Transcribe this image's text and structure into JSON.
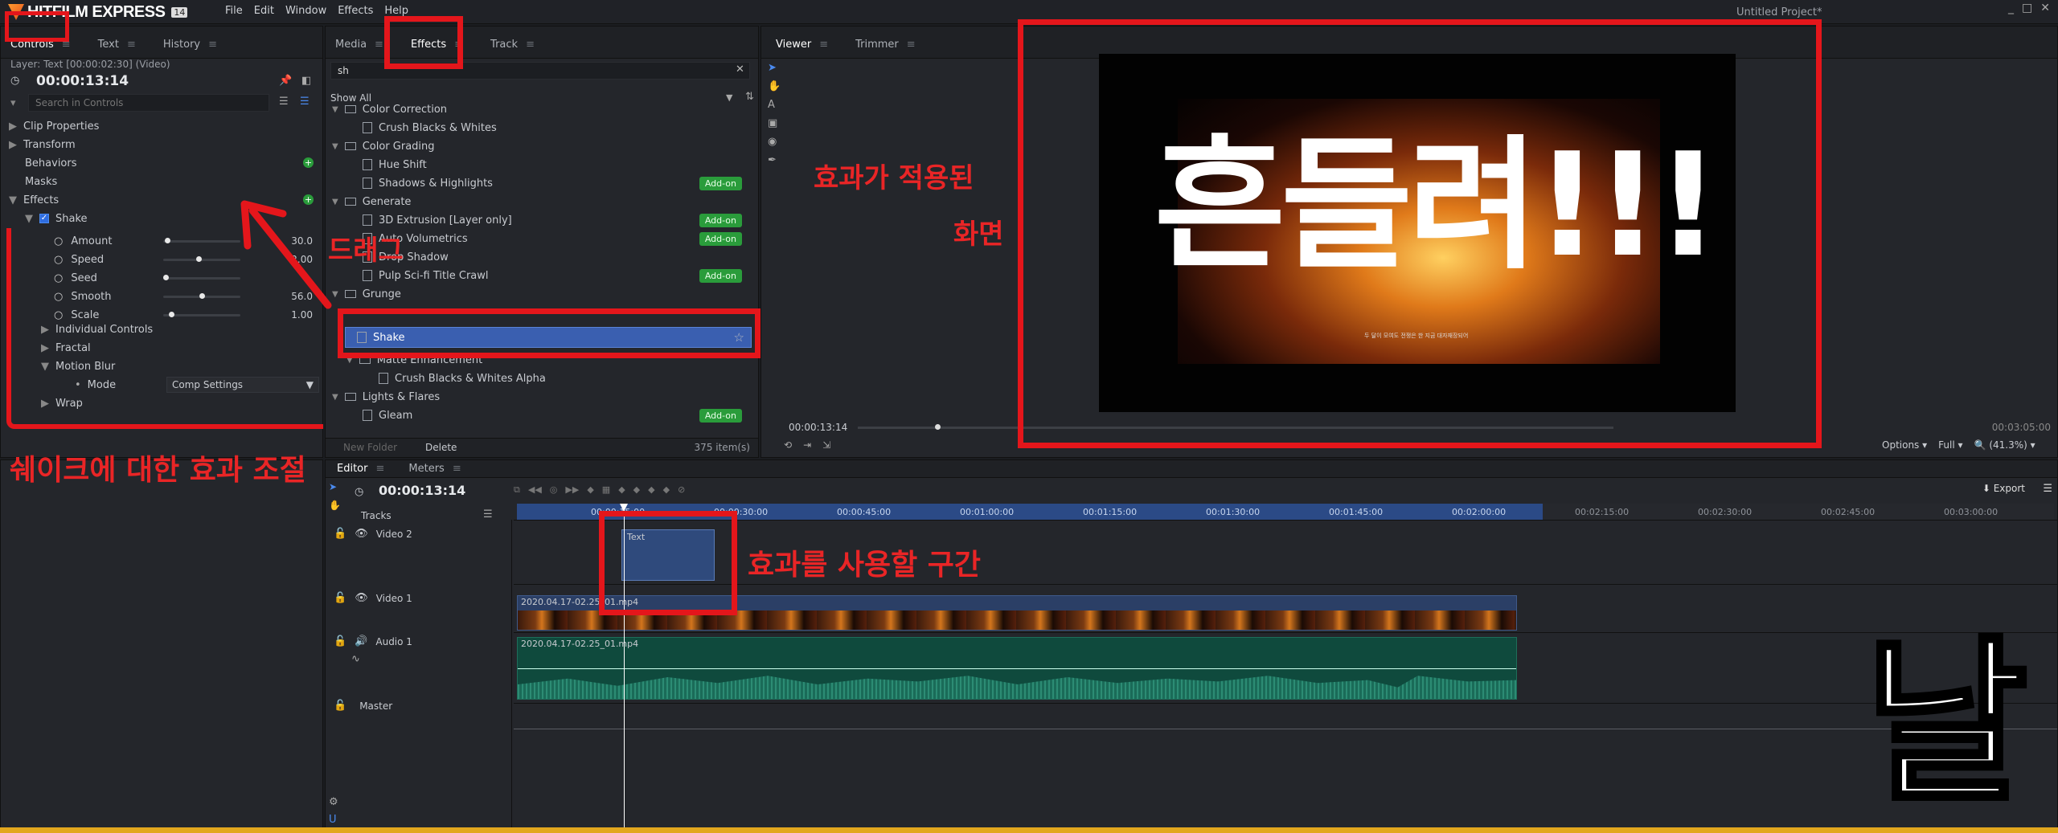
{
  "app": {
    "logo_text": "HITFILM EXPRESS",
    "logo_badge": "14",
    "menu": [
      "File",
      "Edit",
      "Window",
      "Effects",
      "Help"
    ],
    "project_title": "Untitled Project*",
    "window_controls": [
      "_",
      "□",
      "✕"
    ]
  },
  "controls_panel": {
    "tabs": [
      {
        "label": "Controls"
      },
      {
        "label": "Text"
      },
      {
        "label": "History"
      }
    ],
    "layer_info": "Layer: Text [00:00:02:30] (Video)",
    "timecode": "00:00:13:14",
    "search_placeholder": "Search in Controls",
    "tree": {
      "clip_properties": "Clip Properties",
      "transform": "Transform",
      "behaviors": "Behaviors",
      "masks": "Masks",
      "effects": "Effects",
      "shake": "Shake",
      "params": [
        {
          "label": "Amount",
          "value": "30.0",
          "level": 0.02
        },
        {
          "label": "Speed",
          "value": "2.00",
          "level": 0.45
        },
        {
          "label": "Seed",
          "value": "",
          "level": 0.0
        },
        {
          "label": "Smooth",
          "value": "56.0",
          "level": 0.5
        },
        {
          "label": "Scale",
          "value": "1.00",
          "level": 0.08
        }
      ],
      "individual_controls": "Individual Controls",
      "fractal": "Fractal",
      "motion_blur": "Motion Blur",
      "mode_label": "Mode",
      "mode_value": "Comp Settings",
      "wrap": "Wrap"
    }
  },
  "effects_panel": {
    "tabs": [
      {
        "label": "Media"
      },
      {
        "label": "Effects"
      },
      {
        "label": "Track"
      }
    ],
    "search_value": "sh",
    "filter": "Show All",
    "items": [
      {
        "type": "folder",
        "label": "Color Correction",
        "addon": ""
      },
      {
        "type": "effect",
        "label": "Crush Blacks & Whites",
        "addon": ""
      },
      {
        "type": "folder",
        "label": "Color Grading",
        "addon": ""
      },
      {
        "type": "effect",
        "label": "Hue Shift",
        "addon": ""
      },
      {
        "type": "effect",
        "label": "Shadows & Highlights",
        "addon": "Add-on"
      },
      {
        "type": "folder",
        "label": "Generate",
        "addon": ""
      },
      {
        "type": "effect",
        "label": "3D Extrusion [Layer only]",
        "addon": "Add-on"
      },
      {
        "type": "effect",
        "label": "Auto Volumetrics",
        "addon": "Add-on"
      },
      {
        "type": "effect",
        "label": "Drop Shadow",
        "addon": ""
      },
      {
        "type": "effect",
        "label": "Pulp Sci-fi Title Crawl",
        "addon": "Add-on"
      },
      {
        "type": "folder",
        "label": "Grunge",
        "addon": ""
      }
    ],
    "selected_item": "Shake",
    "items_after": [
      {
        "type": "subfolder",
        "label": "Matte Enhancement",
        "addon": ""
      },
      {
        "type": "subeffect",
        "label": "Crush Blacks & Whites Alpha",
        "addon": ""
      },
      {
        "type": "folder",
        "label": "Lights & Flares",
        "addon": ""
      },
      {
        "type": "effect",
        "label": "Gleam",
        "addon": "Add-on"
      }
    ],
    "new_folder": "New Folder",
    "delete": "Delete",
    "item_count": "375 item(s)"
  },
  "viewer": {
    "tabs": [
      {
        "label": "Viewer"
      },
      {
        "label": "Trimmer"
      }
    ],
    "big_text": "흔들려!!!",
    "small_caption": "두 달이 모여도 전쟁은 한 지금 대자재장되어",
    "timecode_left": "00:00:13:14",
    "timecode_right": "00:03:05:00",
    "options": "Options",
    "quality": "Full",
    "zoom": "(41.3%)"
  },
  "editor": {
    "tabs": [
      {
        "label": "Editor"
      },
      {
        "label": "Meters"
      }
    ],
    "timecode": "00:00:13:14",
    "tracks_label": "Tracks",
    "export": "Export",
    "ruler": [
      "00:00:15:00",
      "00:00:30:00",
      "00:00:45:00",
      "00:01:00:00",
      "00:01:15:00",
      "00:01:30:00",
      "00:01:45:00",
      "00:02:00:00",
      "00:02:15:00",
      "00:02:30:00",
      "00:02:45:00",
      "00:03:00:00"
    ],
    "tracks": [
      {
        "name": "Video 2",
        "clip": "Text"
      },
      {
        "name": "Video 1",
        "clip": "2020.04.17-02.25_01.mp4"
      },
      {
        "name": "Audio 1",
        "clip": "2020.04.17-02.25_01.mp4"
      },
      {
        "name": "Master",
        "clip": ""
      }
    ]
  },
  "annotations": {
    "drag": "드래그",
    "applied_screen_1": "효과가 적용된",
    "applied_screen_2": "화면",
    "shake_controls": "쉐이크에 대한 효과 조절",
    "use_section": "효과를 사용할 구간",
    "corner": "날"
  },
  "colors": {
    "accent": "#2f6de0",
    "red": "#e4161b",
    "addon": "#2a9c3b",
    "selection": "#3a5fb0"
  }
}
